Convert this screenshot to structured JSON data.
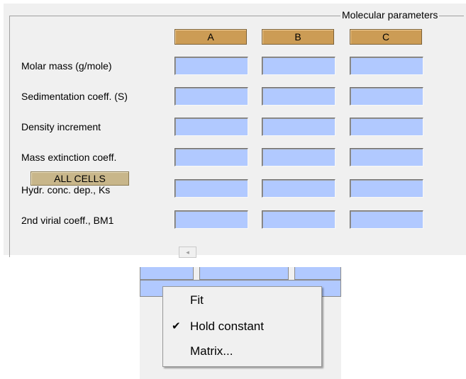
{
  "group": {
    "title": "Molecular parameters"
  },
  "columns": [
    "A",
    "B",
    "C"
  ],
  "rows": [
    {
      "label": "Molar mass (g/mole)"
    },
    {
      "label": "Sedimentation coeff. (S)"
    },
    {
      "label": "Density increment"
    },
    {
      "label": "Mass extinction coeff."
    },
    {
      "label": "Hydr. conc. dep., Ks"
    },
    {
      "label": "2nd virial coeff., BM1"
    }
  ],
  "all_cells_button": {
    "label": "ALL CELLS"
  },
  "scroll": {
    "left_arrow": "◂"
  },
  "context_menu": {
    "items": [
      {
        "label": "Fit",
        "checked": false
      },
      {
        "label": "Hold constant",
        "checked": true
      },
      {
        "label": "Matrix...",
        "checked": false
      }
    ],
    "check_glyph": "✔"
  },
  "colors": {
    "header": "#cc9c55",
    "cell": "#b1c9ff",
    "all_cells": "#c8b68a",
    "panel": "#f0f0f0"
  }
}
